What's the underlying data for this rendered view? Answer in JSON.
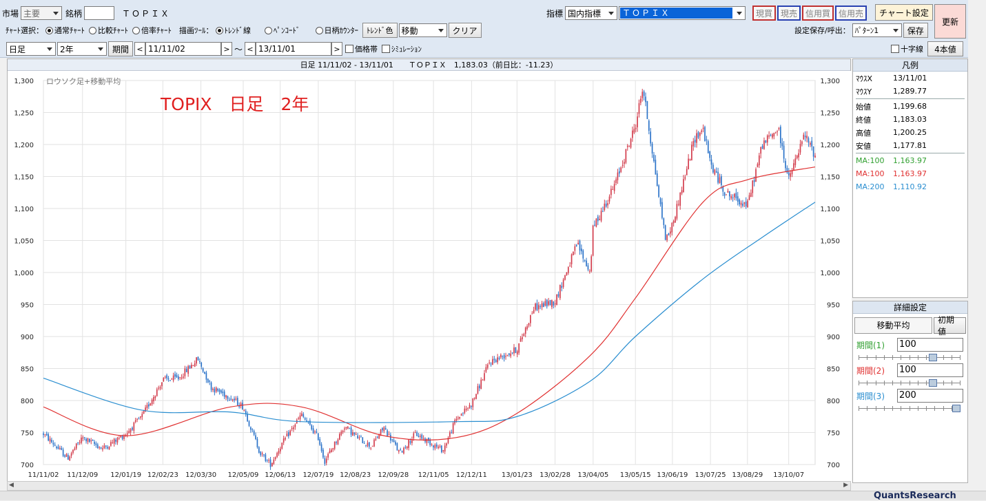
{
  "toolbar": {
    "market_label": "市場",
    "market_value": "主要",
    "symbol_label": "銘柄",
    "symbol_value": "",
    "symbol_name": "ＴＯＰＩＸ",
    "indicator_label": "指標",
    "indicator_type": "国内指標",
    "indicator_value": "ＴＯＰＩＸ",
    "btn_genbai": "現買",
    "btn_genbai_color": "#c03030",
    "btn_genuri": "現売",
    "btn_genuri_color": "#2840b0",
    "btn_shinbai": "信用買",
    "btn_shinuri": "信用売",
    "chart_settings": "チャート設定",
    "refresh": "更新",
    "chart_select_label": "ﾁｬｰﾄ選択：",
    "radio_normal": "通常ﾁｬｰﾄ",
    "radio_compare": "比較ﾁｬｰﾄ",
    "radio_ratio": "倍率ﾁｬｰﾄ",
    "draw_tool_label": "描画ﾂｰﾙ：",
    "radio_trendline": "ﾄﾚﾝﾄﾞ線",
    "radio_pencode": "ﾍﾟﾝｺｰﾄﾞ",
    "radio_counter": "日柄ｶｳﾝﾀｰ",
    "trend_color": "ﾄﾚﾝﾄﾞ色",
    "move_select": "移動",
    "clear": "クリア",
    "save_label": "設定保存/呼出：",
    "pattern_value": "ﾊﾟﾀｰﾝ1",
    "save": "保存",
    "period_type": "日足",
    "span": "2年",
    "period_btn": "期間",
    "date_from": "11/11/02",
    "date_to": "13/11/01",
    "tilde": "～",
    "price_band": "価格帯",
    "simulation": "ｼﾐｭﾚｰｼｮﾝ",
    "crosshair": "十字線",
    "four_values": "4本値"
  },
  "chart_header": "日足 11/11/02 - 13/11/01　　ＴＯＰＩＸ　1,183.03（前日比：-11.23）",
  "chart_data": {
    "type": "candlestick",
    "subtitle": "ロウソク足+移動平均",
    "title": "TOPIX　日足　2年",
    "title_color": "#e02020",
    "ylim": [
      700,
      1300
    ],
    "y_ticks": [
      "700",
      "750",
      "800",
      "850",
      "900",
      "950",
      "1,000",
      "1,050",
      "1,100",
      "1,150",
      "1,200",
      "1,250",
      "1,300"
    ],
    "x_ticks": [
      "11/11/02",
      "11/12/09",
      "12/01/19",
      "12/02/23",
      "12/03/30",
      "12/05/09",
      "12/06/13",
      "12/07/19",
      "12/08/23",
      "12/09/28",
      "12/11/05",
      "12/12/11",
      "13/01/23",
      "13/02/28",
      "13/04/05",
      "13/05/15",
      "13/06/19",
      "13/07/25",
      "13/08/29",
      "13/10/07"
    ],
    "up_color": "#d23a4a",
    "down_color": "#2a72c8",
    "grid": true,
    "close_path": [
      {
        "date": "11/11/02",
        "close": 748
      },
      {
        "date": "11/11/25",
        "close": 710
      },
      {
        "date": "11/12/09",
        "close": 742
      },
      {
        "date": "11/12/28",
        "close": 725
      },
      {
        "date": "12/01/19",
        "close": 748
      },
      {
        "date": "12/02/03",
        "close": 775
      },
      {
        "date": "12/02/23",
        "close": 832
      },
      {
        "date": "12/03/09",
        "close": 835
      },
      {
        "date": "12/03/27",
        "close": 865
      },
      {
        "date": "12/04/09",
        "close": 820
      },
      {
        "date": "12/04/27",
        "close": 805
      },
      {
        "date": "12/05/09",
        "close": 790
      },
      {
        "date": "12/05/25",
        "close": 718
      },
      {
        "date": "12/06/04",
        "close": 700
      },
      {
        "date": "12/06/13",
        "close": 728
      },
      {
        "date": "12/07/03",
        "close": 778
      },
      {
        "date": "12/07/19",
        "close": 742
      },
      {
        "date": "12/07/25",
        "close": 705
      },
      {
        "date": "12/08/13",
        "close": 760
      },
      {
        "date": "12/08/23",
        "close": 745
      },
      {
        "date": "12/09/07",
        "close": 728
      },
      {
        "date": "12/09/19",
        "close": 758
      },
      {
        "date": "12/10/04",
        "close": 718
      },
      {
        "date": "12/10/19",
        "close": 748
      },
      {
        "date": "12/11/14",
        "close": 722
      },
      {
        "date": "12/11/26",
        "close": 770
      },
      {
        "date": "12/12/11",
        "close": 795
      },
      {
        "date": "12/12/28",
        "close": 860
      },
      {
        "date": "13/01/23",
        "close": 880
      },
      {
        "date": "13/02/08",
        "close": 945
      },
      {
        "date": "13/02/28",
        "close": 955
      },
      {
        "date": "13/03/21",
        "close": 1045
      },
      {
        "date": "13/04/02",
        "close": 1000
      },
      {
        "date": "13/04/05",
        "close": 1070
      },
      {
        "date": "13/04/25",
        "close": 1135
      },
      {
        "date": "13/05/15",
        "close": 1230
      },
      {
        "date": "13/05/22",
        "close": 1290
      },
      {
        "date": "13/06/07",
        "close": 1110
      },
      {
        "date": "13/06/13",
        "close": 1050
      },
      {
        "date": "13/06/19",
        "close": 1075
      },
      {
        "date": "13/07/10",
        "close": 1210
      },
      {
        "date": "13/07/18",
        "close": 1225
      },
      {
        "date": "13/07/25",
        "close": 1170
      },
      {
        "date": "13/08/08",
        "close": 1125
      },
      {
        "date": "13/08/29",
        "close": 1105
      },
      {
        "date": "13/09/12",
        "close": 1200
      },
      {
        "date": "13/09/27",
        "close": 1225
      },
      {
        "date": "13/10/07",
        "close": 1145
      },
      {
        "date": "13/10/22",
        "close": 1215
      },
      {
        "date": "13/11/01",
        "close": 1183
      }
    ],
    "series": [
      {
        "name": "MA:100",
        "color": "#e03030",
        "points": [
          {
            "date": "11/11/02",
            "value": 790
          },
          {
            "date": "12/01/19",
            "value": 745
          },
          {
            "date": "12/04/27",
            "value": 790
          },
          {
            "date": "12/07/03",
            "value": 790
          },
          {
            "date": "12/09/19",
            "value": 745
          },
          {
            "date": "12/11/26",
            "value": 742
          },
          {
            "date": "13/01/23",
            "value": 780
          },
          {
            "date": "13/04/02",
            "value": 870
          },
          {
            "date": "13/05/15",
            "value": 960
          },
          {
            "date": "13/07/18",
            "value": 1110
          },
          {
            "date": "13/08/29",
            "value": 1145
          },
          {
            "date": "13/11/01",
            "value": 1165
          }
        ]
      },
      {
        "name": "MA:200",
        "color": "#2a8ed0",
        "points": [
          {
            "date": "11/11/02",
            "value": 835
          },
          {
            "date": "12/02/03",
            "value": 785
          },
          {
            "date": "12/04/27",
            "value": 782
          },
          {
            "date": "12/07/03",
            "value": 767
          },
          {
            "date": "12/11/26",
            "value": 767
          },
          {
            "date": "13/01/23",
            "value": 775
          },
          {
            "date": "13/04/02",
            "value": 830
          },
          {
            "date": "13/05/15",
            "value": 900
          },
          {
            "date": "13/07/18",
            "value": 990
          },
          {
            "date": "13/09/12",
            "value": 1055
          },
          {
            "date": "13/11/01",
            "value": 1110
          }
        ]
      }
    ]
  },
  "legend": {
    "title": "凡例",
    "mouse_x_label": "ﾏｳｽX",
    "mouse_x": "13/11/01",
    "mouse_y_label": "ﾏｳｽY",
    "mouse_y": "1,289.77",
    "open_label": "始値",
    "open": "1,199.68",
    "close_label": "終値",
    "close": "1,183.03",
    "high_label": "高値",
    "high": "1,200.25",
    "low_label": "安値",
    "low": "1,177.81",
    "ma1_label": "MA:100",
    "ma1": "1,163.97",
    "ma1_color": "#30a030",
    "ma2_label": "MA:100",
    "ma2": "1,163.97",
    "ma2_color": "#e03030",
    "ma3_label": "MA:200",
    "ma3": "1,110.92",
    "ma3_color": "#2a8ed0"
  },
  "details": {
    "title": "詳細設定",
    "tab_ma": "移動平均",
    "initial": "初期値",
    "p1_label": "期間(1)",
    "p1_value": "100",
    "p1_level": 0.75,
    "p2_label": "期間(2)",
    "p2_value": "100",
    "p2_level": 0.75,
    "p3_label": "期間(3)",
    "p3_value": "200",
    "p3_level": 1.0
  },
  "footer_logo": "QuantsResearch"
}
